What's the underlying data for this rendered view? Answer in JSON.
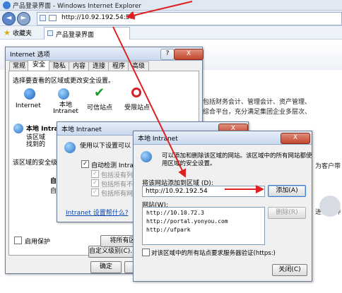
{
  "browser": {
    "window_title": "产品登录界面 - Windows Internet Explorer",
    "address": "http://10.92.192.54:57/",
    "favorites_label": "收藏夹",
    "tab_title": "产品登录界面"
  },
  "background_page": {
    "lines": [
      "包括财务会计、管理会计、资产管理、",
      "综合平台，充分满足集团企业多层次、",
      "为客户带",
      "进行各种"
    ]
  },
  "internet_options": {
    "title": "Internet 选项",
    "help_btn": "?",
    "close_btn": "X",
    "tabs": [
      "常规",
      "安全",
      "隐私",
      "内容",
      "连接",
      "程序",
      "高级"
    ],
    "zone_prompt": "选择要查看的区域或更改安全设置。",
    "zones": [
      "Internet",
      "本地 Intranet",
      "可信站点",
      "受限站点"
    ],
    "zone_title": "本地 Intranet",
    "zone_desc": [
      "该区域",
      "找到的"
    ],
    "level_label": "该区域的安全级别(L)",
    "level_custom": "自定",
    "level_custom_sub": "自定",
    "protected_mode": "启用保护",
    "custom_level_btn": "自定义级别(C)...",
    "default_btn": "将所有区域",
    "ok_btn": "确定",
    "cancel_btn": "取消"
  },
  "local_intranet": {
    "title": "本地 Intranet",
    "desc": "使用以下设置可以",
    "auto_detect": "自动检测 Intranet",
    "option1": "包括没有列在",
    "option2": "包括所有不使",
    "option3": "包括所有网络",
    "link": "Intranet 设置帮什么?"
  },
  "add_dialog": {
    "title": "本地 Intranet",
    "close_btn": "关闭",
    "desc_line1": "可以添加和删除该区域的网站。该区域中的所有网站都使",
    "desc_line2": "用区域的安全设置。",
    "add_label": "将该网站添加到区域 (D):",
    "add_value": "http://10.92.192.54",
    "add_btn": "添加(A)",
    "sites_label": "网站(W):",
    "sites": [
      "http://10.10.72.3",
      "http://portal.yonyou.com",
      "http://ufpark"
    ],
    "remove_btn": "删除(R)",
    "https_label": "对该区域中的所有站点要求服务器验证(https:)",
    "close_label": "关闭(C)"
  }
}
